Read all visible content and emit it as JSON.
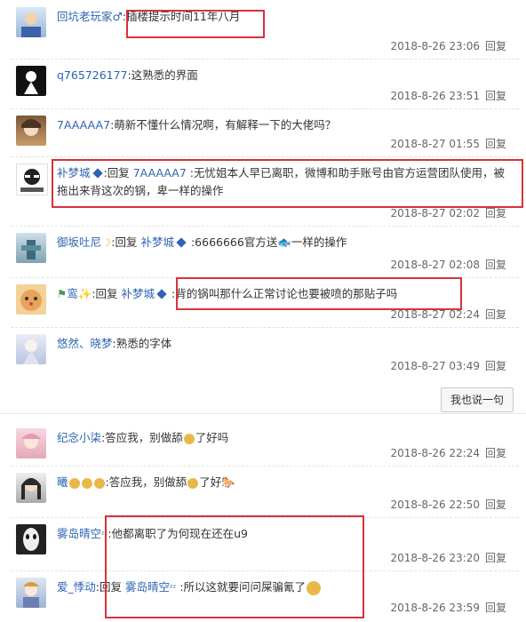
{
  "panel_a": {
    "comments": [
      {
        "user": "回坑老玩家",
        "icon": "male-icon",
        "sep": ":",
        "text": "插楼提示时间11年八月",
        "date": "2018-8-26 23:06",
        "reply": "回复"
      },
      {
        "user": "q765726177",
        "sep": ":",
        "text": "这熟悉的界面",
        "date": "2018-8-26 23:51",
        "reply": "回复"
      },
      {
        "user": "7AAAAA7",
        "sep": ":",
        "text": "萌新不懂什么情况啊，有解释一下的大佬吗？",
        "date": "2018-8-27 01:55",
        "reply": "回复"
      },
      {
        "user": "补梦城",
        "badge": "◆",
        "sep": ":",
        "reply_prefix": "回复",
        "reply_to": "7AAAAA7",
        "text": ":无忧姐本人早已离职，微博和助手账号由官方运营团队使用，被拖出来背这次的锅，卑一样的操作",
        "date": "2018-8-27 02:02",
        "reply": "回复"
      },
      {
        "user": "御坂吐尼",
        "icon": "moon-emoji",
        "sep": ":",
        "reply_prefix": "回复",
        "reply_to": "补梦城",
        "reply_badge": "◆",
        "text": ":6666666官方送",
        "text_tail": "一样的操作",
        "date": "2018-8-27 02:08",
        "reply": "回复"
      },
      {
        "user": "鸾",
        "icon": "sparkle-emoji",
        "sep": ":",
        "reply_prefix": "回复",
        "reply_to": "补梦城",
        "reply_badge": "◆",
        "text": ":背的锅叫那什么正常讨论也要被喷的那贴子吗",
        "date": "2018-8-27 02:24",
        "reply": "回复"
      },
      {
        "user": "悠然、晓梦",
        "sep": ":",
        "text": "熟悉的字体",
        "date": "2018-8-27 03:49",
        "reply": "回复"
      }
    ],
    "more_button": "我也说一句"
  },
  "panel_b": {
    "comments": [
      {
        "user": "纪念小柒",
        "sep": ":",
        "text": "答应我，别做舔",
        "text_tail": "了好吗",
        "date": "2018-8-26 22:24",
        "reply": "回复"
      },
      {
        "user": "曦",
        "emoji_count": 3,
        "sep": ":",
        "text": "答应我，别做舔",
        "text_tail": "了好",
        "date": "2018-8-26 22:50",
        "reply": "回复"
      },
      {
        "user": "雾岛晴空",
        "icon": "zz-emoji",
        "sep": ":",
        "text": "他都离职了为何现在还在u9",
        "date": "2018-8-26 23:20",
        "reply": "回复"
      },
      {
        "user": "爱_悸动",
        "sep": ":",
        "reply_prefix": "回复",
        "reply_to": "雾岛晴空",
        "text": ":所以这就要问问屎骗氰了",
        "date": "2018-8-26 23:59",
        "reply": "回复"
      }
    ]
  },
  "colors": {
    "username": "#2d64b3",
    "highlight": "#d9313a",
    "meta": "#666666"
  }
}
